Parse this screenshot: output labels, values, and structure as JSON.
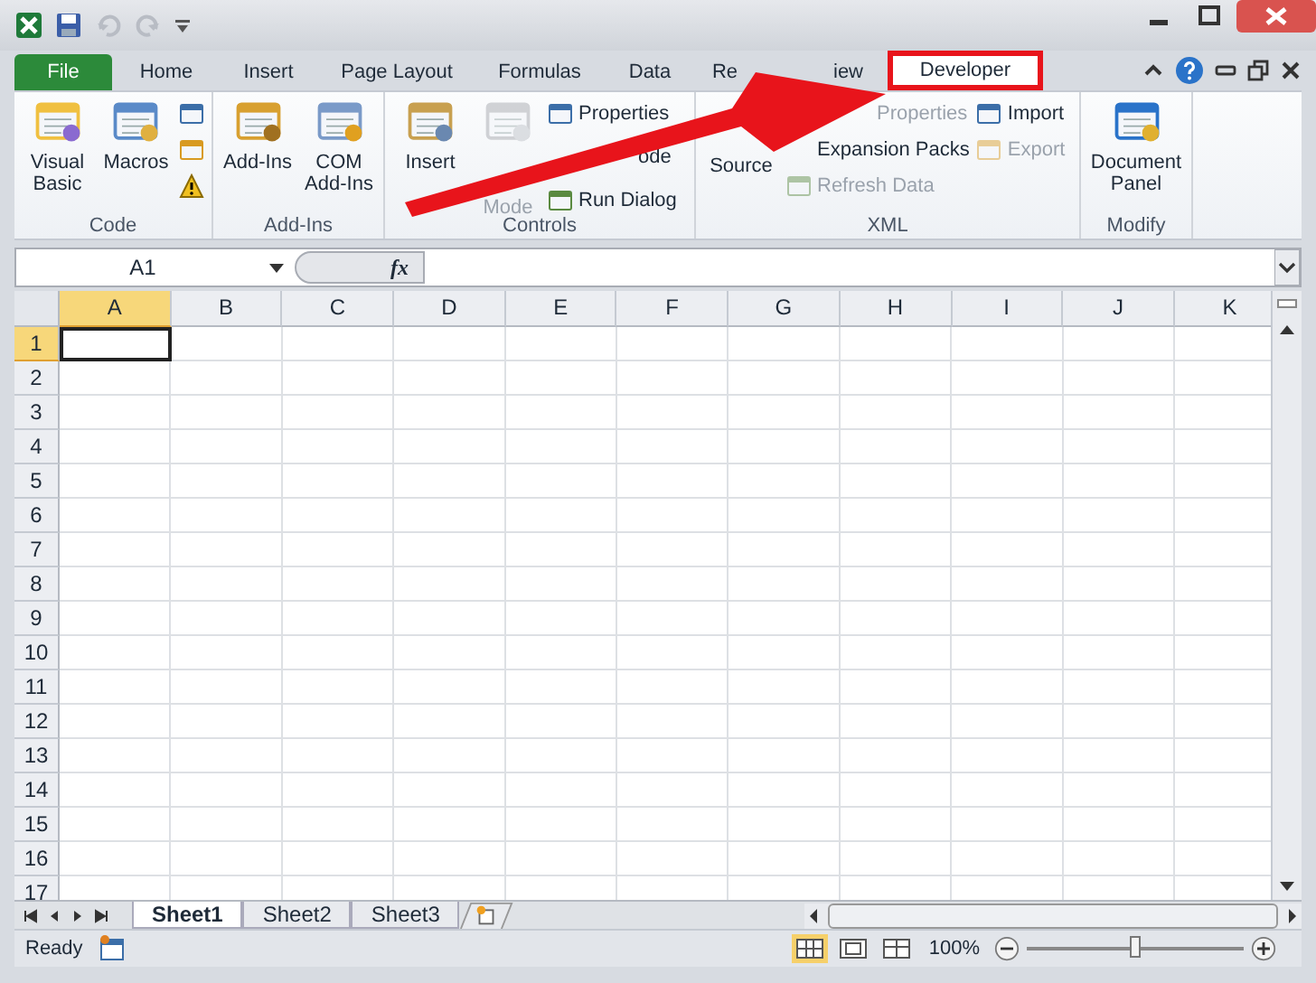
{
  "pointer_arrow": true,
  "tabs": [
    {
      "label": "File",
      "kind": "file",
      "selected": false,
      "annotated": false
    },
    {
      "label": "Home",
      "kind": "tab",
      "selected": false,
      "annotated": false
    },
    {
      "label": "Insert",
      "kind": "tab",
      "selected": false,
      "annotated": false
    },
    {
      "label": "Page Layout",
      "kind": "tab",
      "selected": false,
      "annotated": false
    },
    {
      "label": "Formulas",
      "kind": "tab",
      "selected": false,
      "annotated": false
    },
    {
      "label": "Data",
      "kind": "tab",
      "selected": false,
      "annotated": false
    },
    {
      "label": "Re",
      "kind": "tab",
      "selected": false,
      "annotated": false
    },
    {
      "label": "iew",
      "kind": "tab",
      "selected": false,
      "annotated": false
    },
    {
      "label": "Developer",
      "kind": "tab",
      "selected": true,
      "annotated": true
    }
  ],
  "ribbon": [
    {
      "label": "Code",
      "items": [
        {
          "kind": "large",
          "label": "Visual Basic",
          "disabled": false
        },
        {
          "kind": "large",
          "label": "Macros",
          "disabled": false
        },
        {
          "kind": "iconstack"
        }
      ]
    },
    {
      "label": "Add-Ins",
      "items": [
        {
          "kind": "large",
          "label": "Add-Ins",
          "disabled": false
        },
        {
          "kind": "large",
          "label": "COM Add-Ins",
          "disabled": false
        }
      ]
    },
    {
      "label": "Controls",
      "items": [
        {
          "kind": "large",
          "label": "Insert",
          "disabled": false
        },
        {
          "kind": "large_tail",
          "label": "Mode",
          "disabled": true
        },
        {
          "kind": "small",
          "rows": [
            {
              "kind": "row",
              "label": "Properties",
              "disabled": false
            },
            {
              "kind": "tail",
              "label": "ode",
              "disabled": false
            },
            {
              "kind": "row",
              "label": "Run Dialog",
              "disabled": false
            }
          ]
        }
      ]
    },
    {
      "label": "XML",
      "items": [
        {
          "kind": "label_only",
          "label": "Source",
          "disabled": false
        },
        {
          "kind": "small",
          "rows": [
            {
              "kind": "tail",
              "label": "Properties",
              "disabled": true
            },
            {
              "kind": "tail_icon_gap",
              "label": "Expansion Packs",
              "disabled": false
            },
            {
              "kind": "row",
              "label": "Refresh Data",
              "disabled": true
            }
          ]
        },
        {
          "kind": "small",
          "rows": [
            {
              "kind": "row",
              "label": "Import",
              "disabled": false
            },
            {
              "kind": "row",
              "label": "Export",
              "disabled": true
            }
          ]
        }
      ]
    },
    {
      "label": "Modify",
      "items": [
        {
          "kind": "large",
          "label": "Document Panel",
          "disabled": false
        }
      ]
    }
  ],
  "name_box": "A1",
  "function_label": "fx",
  "columns": [
    {
      "label": "A",
      "selected": true
    },
    {
      "label": "B",
      "selected": false
    },
    {
      "label": "C",
      "selected": false
    },
    {
      "label": "D",
      "selected": false
    },
    {
      "label": "E",
      "selected": false
    },
    {
      "label": "F",
      "selected": false
    },
    {
      "label": "G",
      "selected": false
    },
    {
      "label": "H",
      "selected": false
    },
    {
      "label": "I",
      "selected": false
    },
    {
      "label": "J",
      "selected": false
    },
    {
      "label": "K",
      "selected": false
    }
  ],
  "rows": [
    {
      "label": "1",
      "selected": true
    },
    {
      "label": "2",
      "selected": false
    },
    {
      "label": "3",
      "selected": false
    },
    {
      "label": "4",
      "selected": false
    },
    {
      "label": "5",
      "selected": false
    },
    {
      "label": "6",
      "selected": false
    },
    {
      "label": "7",
      "selected": false
    },
    {
      "label": "8",
      "selected": false
    },
    {
      "label": "9",
      "selected": false
    },
    {
      "label": "10",
      "selected": false
    },
    {
      "label": "11",
      "selected": false
    },
    {
      "label": "12",
      "selected": false
    },
    {
      "label": "13",
      "selected": false
    },
    {
      "label": "14",
      "selected": false
    },
    {
      "label": "15",
      "selected": false
    },
    {
      "label": "16",
      "selected": false
    },
    {
      "label": "17",
      "selected": false
    }
  ],
  "sheets": [
    {
      "label": "Sheet1",
      "selected": true
    },
    {
      "label": "Sheet2",
      "selected": false
    },
    {
      "label": "Sheet3",
      "selected": false
    }
  ],
  "status_bar": {
    "text": "Ready",
    "zoom": "100%",
    "level": 0.5
  }
}
